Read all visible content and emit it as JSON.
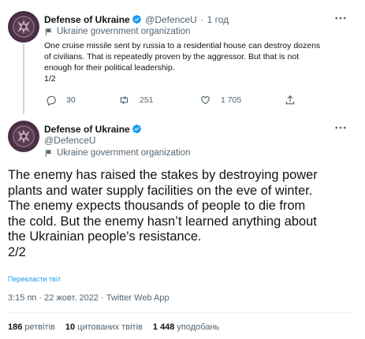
{
  "tweet1": {
    "author": "Defense of Ukraine",
    "handle": "@DefenceU",
    "separator": "·",
    "time": "1 год",
    "label": "Ukraine government organization",
    "text_lines": [
      "One cruise missile sent by russia to a residential house can destroy dozens",
      "of civilians. That is repeatedly proven by the aggressor. But that is not",
      "enough for their political leadership.",
      "1/2"
    ],
    "replies": "30",
    "retweets": "251",
    "likes": "1 705"
  },
  "tweet2": {
    "author": "Defense of Ukraine",
    "handle": "@DefenceU",
    "label": "Ukraine government organization",
    "text_lines": [
      "The enemy has raised the stakes by destroying power",
      "plants and water supply facilities on the eve of winter.",
      "The enemy expects thousands of people to die from",
      "the cold. But the enemy hasn’t learned anything about",
      "the Ukrainian people's resistance.",
      "2/2"
    ],
    "translate": "Перекласти твіт",
    "timestamp": "3:15 пп · 22 жовт. 2022 · Twitter Web App",
    "stats": {
      "retweets_count": "186",
      "retweets_label": "ретвітів",
      "quotes_count": "10",
      "quotes_label": "цитованих твітів",
      "likes_count": "1 448",
      "likes_label": "уподобань"
    }
  },
  "colors": {
    "text": "#0f1419",
    "muted": "#536471",
    "accent": "#1d9bf0",
    "avatar": "#4a2f45"
  },
  "icons": [
    "ukraine-trident-avatar-icon",
    "verified-badge-icon",
    "government-flag-icon",
    "more-dots-icon",
    "reply-icon",
    "retweet-icon",
    "like-icon",
    "share-icon"
  ]
}
